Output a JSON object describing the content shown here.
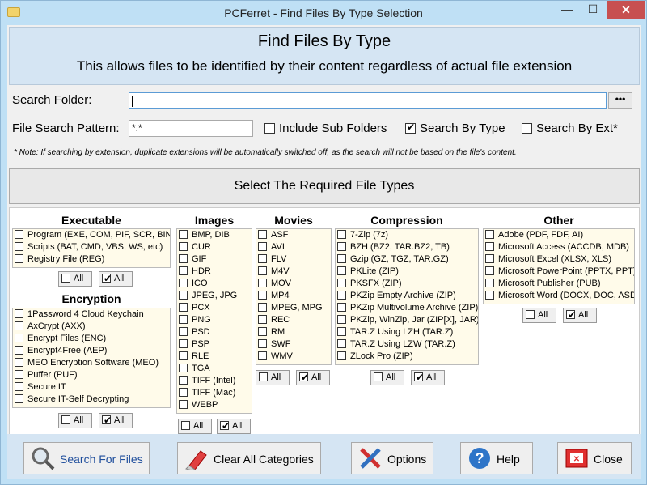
{
  "window": {
    "title": "PCFerret - Find Files By Type Selection",
    "minimize": "—",
    "maximize": "☐",
    "close": "✕"
  },
  "header": {
    "title": "Find Files By Type",
    "subtitle": "This allows files to be identified by their content regardless of actual file extension"
  },
  "search": {
    "folder_label": "Search Folder:",
    "folder_value": "",
    "browse_label": "•••",
    "pattern_label": "File Search Pattern:",
    "pattern_value": "*.*",
    "include_sub": "Include Sub Folders",
    "by_type": "Search By Type",
    "by_ext": "Search By Ext*",
    "include_sub_checked": false,
    "by_type_checked": true,
    "by_ext_checked": false
  },
  "note": "* Note: If searching by extension, duplicate extensions will be automatically switched off, as the search will not be based on the file's content.",
  "section_title": "Select The Required File Types",
  "all_label": "All",
  "categories": {
    "executable": {
      "title": "Executable",
      "items": [
        "Program (EXE, COM, PIF, SCR, BIN)",
        "Scripts (BAT, CMD, VBS, WS, etc)",
        "Registry File (REG)"
      ]
    },
    "encryption": {
      "title": "Encryption",
      "items": [
        "1Password 4 Cloud Keychain",
        "AxCrypt (AXX)",
        "Encrypt Files (ENC)",
        "Encrypt4Free (AEP)",
        "MEO Encryption Software (MEO)",
        "Puffer (PUF)",
        "Secure IT",
        "Secure IT-Self Decrypting"
      ]
    },
    "images": {
      "title": "Images",
      "items": [
        "BMP, DIB",
        "CUR",
        "GIF",
        "HDR",
        "ICO",
        "JPEG, JPG",
        "PCX",
        "PNG",
        "PSD",
        "PSP",
        "RLE",
        "TGA",
        "TIFF (Intel)",
        "TIFF (Mac)",
        "WEBP"
      ]
    },
    "movies": {
      "title": "Movies",
      "items": [
        "ASF",
        "AVI",
        "FLV",
        "M4V",
        "MOV",
        "MP4",
        "MPEG, MPG",
        "REC",
        "RM",
        "SWF",
        "WMV"
      ]
    },
    "compression": {
      "title": "Compression",
      "items": [
        "7-Zip (7z)",
        "BZH (BZ2, TAR.BZ2, TB)",
        "Gzip (GZ, TGZ, TAR.GZ)",
        "PKLite (ZIP)",
        "PKSFX (ZIP)",
        "PKZip Empty Archive (ZIP)",
        "PKZip Multivolume Archive (ZIP)",
        "PKZip, WinZip, Jar (ZIP[X], JAR)",
        "TAR.Z Using LZH (TAR.Z)",
        "TAR.Z Using LZW (TAR.Z)",
        "ZLock Pro (ZIP)"
      ]
    },
    "other": {
      "title": "Other",
      "items": [
        "Adobe (PDF, FDF, AI)",
        "Microsoft Access (ACCDB, MDB)",
        "Microsoft Excel (XLSX, XLS)",
        "Microsoft PowerPoint (PPTX, PPT)",
        "Microsoft Publisher (PUB)",
        "Microsoft Word (DOCX, DOC, ASD)"
      ]
    }
  },
  "footer": {
    "search": "Search For Files",
    "clear": "Clear All Categories",
    "options": "Options",
    "help": "Help",
    "close": "Close"
  },
  "colors": {
    "title_bg": "#bfe0f5",
    "close_bg": "#c75050",
    "header_bg": "#d5e5f3",
    "list_bg": "#fffbea",
    "search_text": "#1f4e9c"
  }
}
